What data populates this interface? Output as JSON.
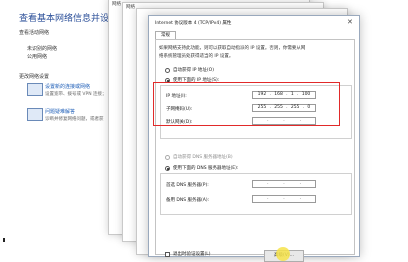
{
  "background": {
    "title": "查看基本网络信息并设置连接",
    "active_networks": "查看活动网络",
    "network_name": "未识别的网络",
    "network_type": "公用网络",
    "change_settings": "更改网络设置",
    "item1_title": "设置新的连接或网络",
    "item1_desc": "设置宽带、拨号或 VPN 连接；",
    "item2_title": "问题疑难解答",
    "item2_desc": "诊断并修复网络问题，或者获"
  },
  "behind_windows": {
    "tab1": "网络",
    "tab2": "共享"
  },
  "dialog": {
    "title": "Internet 协议版本 4 (TCP/IPv4) 属性",
    "close": "✕",
    "tab_general": "常规",
    "description_line1": "如果网络支持此功能，则可以获取自动指派的 IP 设置。否则，你需要从网",
    "description_line2": "络系统管理员处获得适当的 IP 设置。",
    "radio_auto_ip": "自动获得 IP 地址(O)",
    "radio_manual_ip": "使用下面的 IP 地址(S):",
    "ip_label": "IP 地址(I):",
    "ip_value": [
      "192",
      "168",
      "1",
      "100"
    ],
    "mask_label": "子网掩码(U):",
    "mask_value": [
      "255",
      "255",
      "255",
      "0"
    ],
    "gateway_label": "默认网关(D):",
    "radio_auto_dns": "自动获得 DNS 服务器地址(B)",
    "radio_manual_dns": "使用下面的 DNS 服务器地址(E):",
    "dns_pref_label": "首选 DNS 服务器(P):",
    "dns_alt_label": "备用 DNS 服务器(A):",
    "validate_label": "退出时验证设置(L)",
    "advanced_button": "高级(V)..."
  },
  "colors": {
    "highlight": "#e12a2a",
    "accent_blue": "#2b4f99",
    "cursor_yellow": "#f6e34a"
  }
}
